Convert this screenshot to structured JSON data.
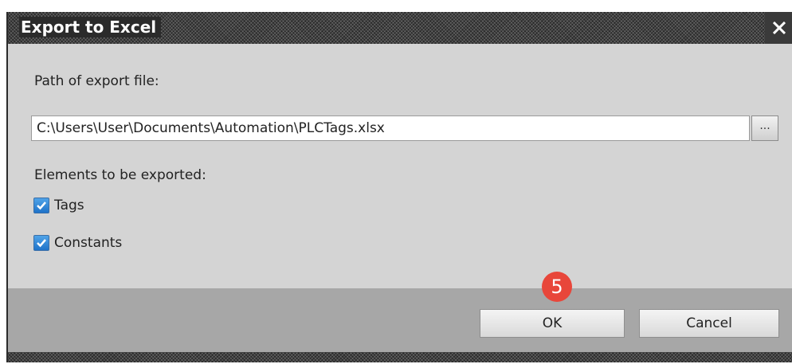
{
  "dialog": {
    "title": "Export to Excel",
    "close_icon": "close-icon",
    "path_label": "Path of export file:",
    "path_value": "C:\\Users\\User\\Documents\\Automation\\PLCTags.xlsx",
    "browse_label": "...",
    "elements_label": "Elements to be exported:",
    "options": [
      {
        "label": "Tags",
        "checked": true
      },
      {
        "label": "Constants",
        "checked": true
      }
    ],
    "ok_label": "OK",
    "cancel_label": "Cancel",
    "step_badge": "5"
  },
  "colors": {
    "title_bar": "#2b2b2b",
    "dialog_bg": "#d4d4d4",
    "footer_bg": "#a7a7a7",
    "checkbox": "#1f73c9",
    "badge": "#e8463a"
  }
}
